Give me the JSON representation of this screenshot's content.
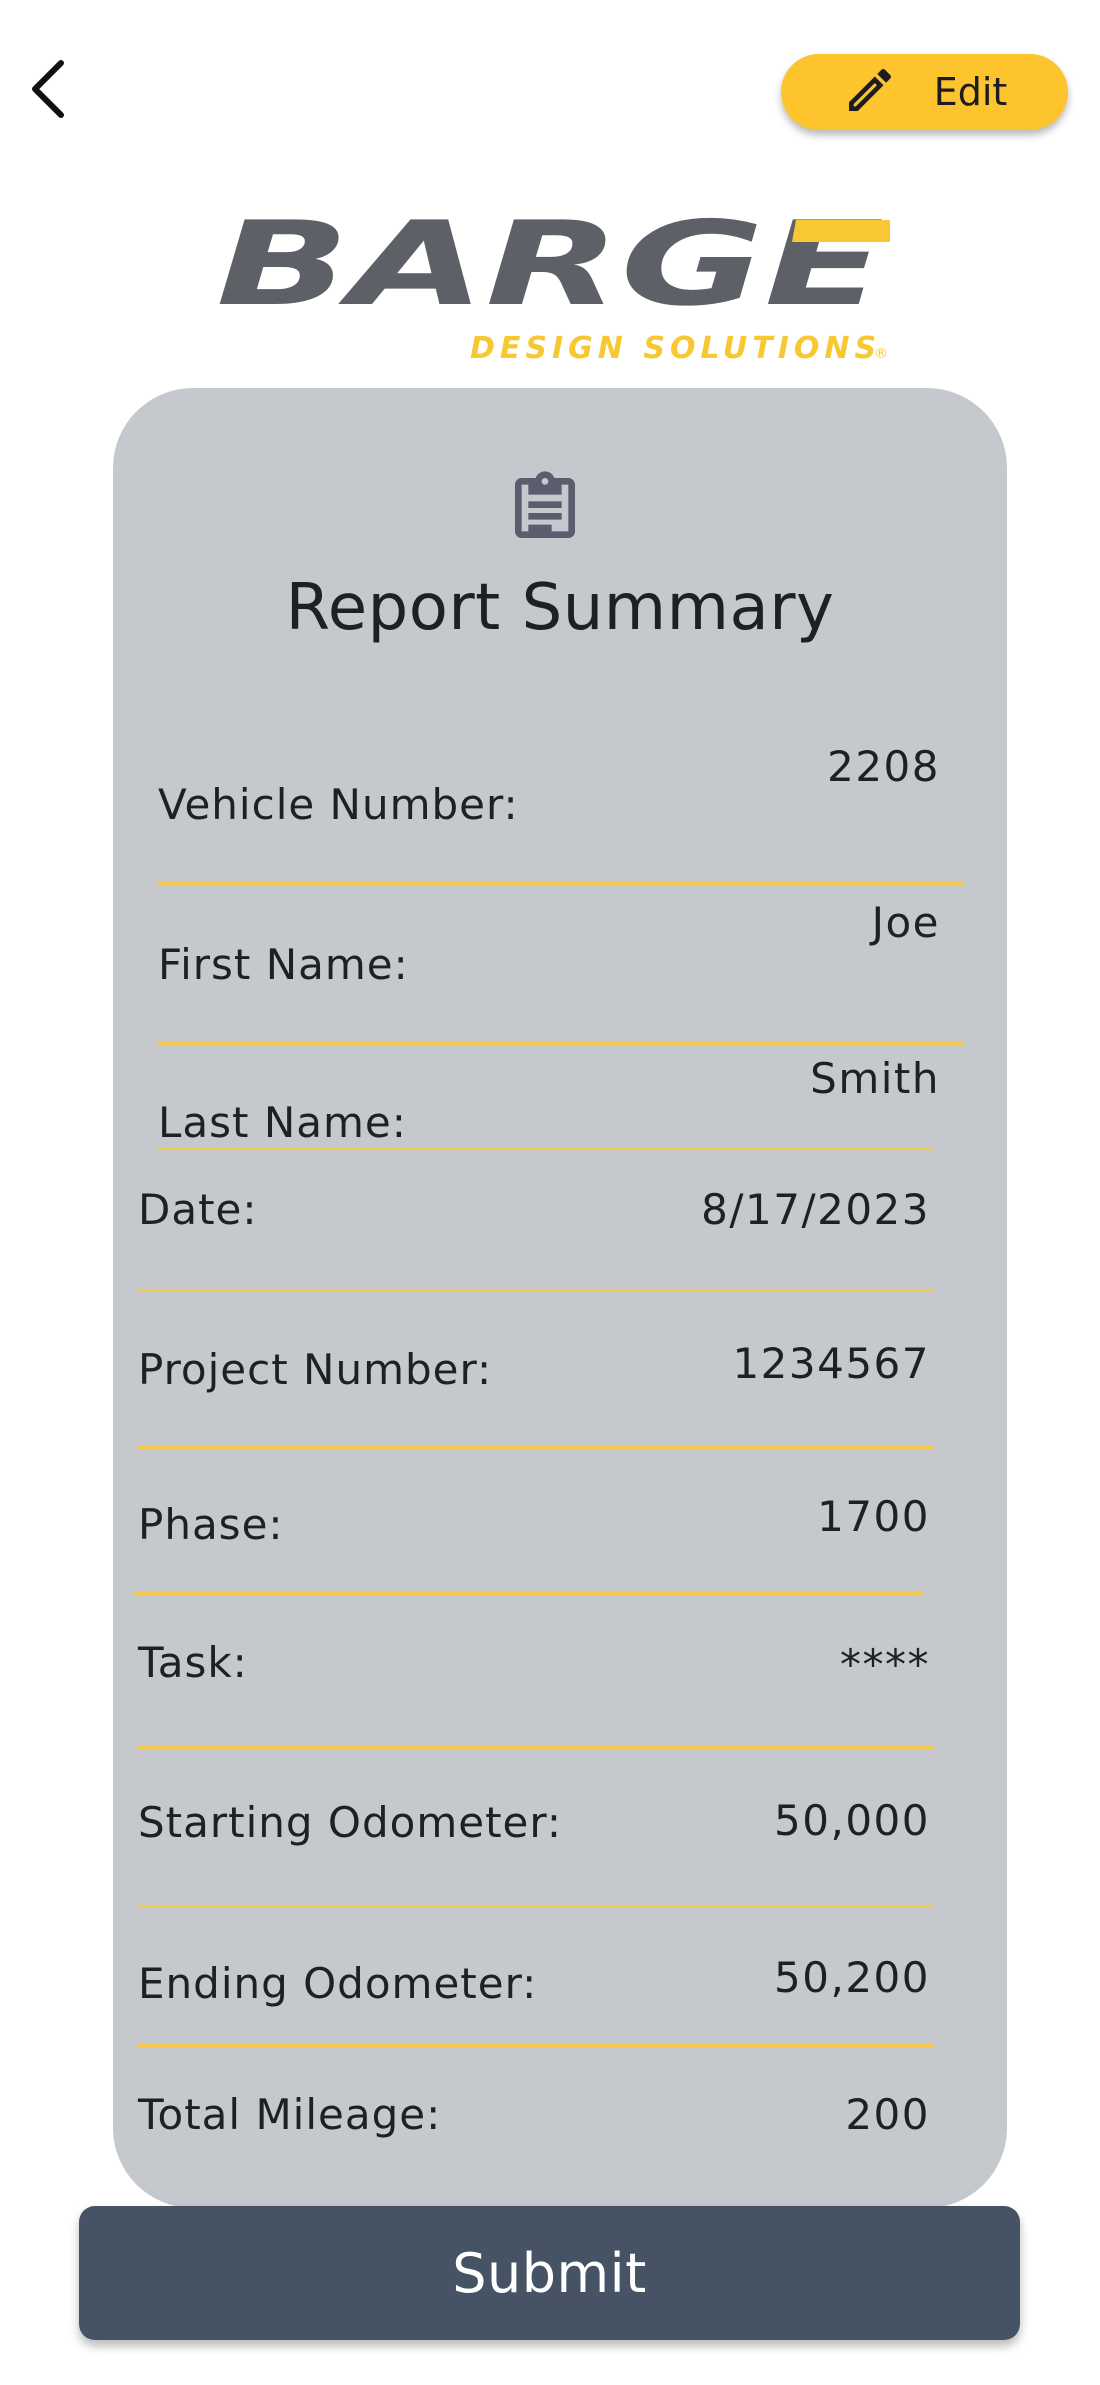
{
  "header": {
    "back_icon": "chevron-left-icon",
    "edit_label": "Edit",
    "edit_icon": "pencil-icon"
  },
  "logo": {
    "brand": "BARGE",
    "tagline": "DESIGN SOLUTIONS",
    "registered": "®",
    "colors": {
      "grey": "#5d6167",
      "yellow": "#f7c832"
    }
  },
  "card": {
    "icon": "clipboard-icon",
    "title": "Report Summary",
    "rows": [
      {
        "label": "Vehicle Number:",
        "value": "2208"
      },
      {
        "label": "First Name:",
        "value": "Joe"
      },
      {
        "label": "Last Name:",
        "value": "Smith"
      },
      {
        "label": "Date:",
        "value": "8/17/2023"
      },
      {
        "label": "Project Number:",
        "value": "1234567"
      },
      {
        "label": "Phase:",
        "value": "1700"
      },
      {
        "label": "Task:",
        "value": "****"
      },
      {
        "label": "Starting Odometer:",
        "value": "50,000"
      },
      {
        "label": "Ending Odometer:",
        "value": "50,200"
      },
      {
        "label": "Total Mileage:",
        "value": "200"
      }
    ]
  },
  "footer": {
    "submit_label": "Submit"
  },
  "colors": {
    "accent": "#fdc42e",
    "card_bg": "#c5c8cd",
    "divider": "#f2c94c",
    "submit_bg": "#465365"
  }
}
